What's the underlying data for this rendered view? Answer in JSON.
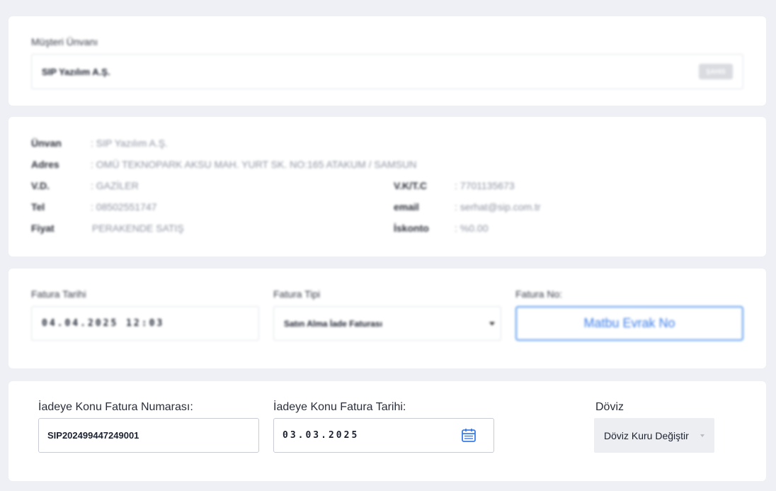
{
  "customer": {
    "label": "Müşteri Ünvanı",
    "value": "SIP Yazılım A.Ş.",
    "badge": "ŞAHIS"
  },
  "info": {
    "unvan_key": "Ünvan",
    "unvan_val": ": SIP Yazılım A.Ş.",
    "adres_key": "Adres",
    "adres_val": ": OMÜ TEKNOPARK AKSU MAH. YURT SK. NO:165 ATAKUM / SAMSUN",
    "vd_key": "V.D.",
    "vd_val": ": GAZİLER",
    "vk_key": "V.K/T.C",
    "vk_val": ": 7701135673",
    "tel_key": "Tel",
    "tel_val": ": 08502551747",
    "email_key": "email",
    "email_val": ": serhat@sip.com.tr",
    "fiyat_key": "Fiyat",
    "fiyat_val": "PERAKENDE SATIŞ",
    "iskonto_key": "İskonto",
    "iskonto_val": ": %0.00"
  },
  "invoice": {
    "date_label": "Fatura Tarihi",
    "date_value": "04.04.2025 12:03",
    "type_label": "Fatura Tipi",
    "type_value": "Satın Alma İade Faturası",
    "no_label": "Fatura No:",
    "no_button": "Matbu Evrak No"
  },
  "return": {
    "number_label": "İadeye Konu Fatura Numarası:",
    "number_value": "SIP202499447249001",
    "date_label": "İadeye Konu Fatura Tarihi:",
    "date_value": "03.03.2025",
    "currency_label": "Döviz",
    "currency_button": "Döviz Kuru Değiştir"
  },
  "colors": {
    "accent": "#3a7de8",
    "card_bg": "#ffffff",
    "page_bg": "#eef0f5"
  }
}
